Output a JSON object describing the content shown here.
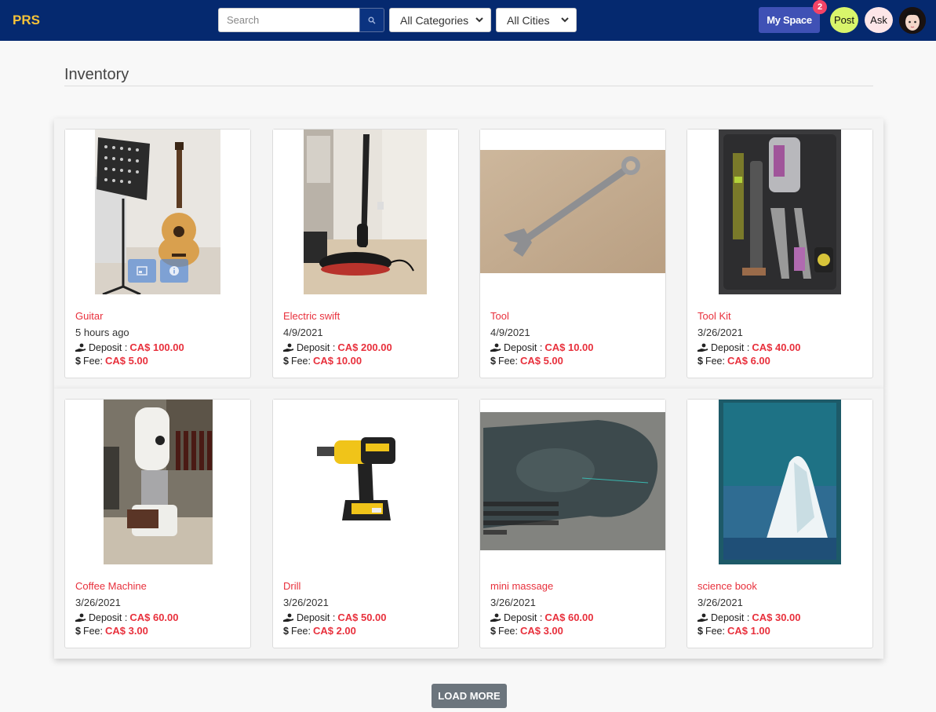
{
  "header": {
    "brand": "PRS",
    "search_placeholder": "Search",
    "category_select": "All Categories",
    "city_select": "All Cities",
    "my_space_label": "My Space",
    "notification_count": "2",
    "post_label": "Post",
    "ask_label": "Ask"
  },
  "page": {
    "title": "Inventory",
    "load_more_label": "LOAD MORE"
  },
  "labels": {
    "deposit": "Deposit :",
    "fee": "Fee:"
  },
  "items": [
    {
      "name": "Guitar",
      "date": "5 hours ago",
      "deposit": "CA$ 100.00",
      "fee": "CA$ 5.00"
    },
    {
      "name": "Electric swift",
      "date": "4/9/2021",
      "deposit": "CA$ 200.00",
      "fee": "CA$ 10.00"
    },
    {
      "name": "Tool",
      "date": "4/9/2021",
      "deposit": "CA$ 10.00",
      "fee": "CA$ 5.00"
    },
    {
      "name": "Tool Kit",
      "date": "3/26/2021",
      "deposit": "CA$ 40.00",
      "fee": "CA$ 6.00"
    },
    {
      "name": "Coffee Machine",
      "date": "3/26/2021",
      "deposit": "CA$ 60.00",
      "fee": "CA$ 3.00"
    },
    {
      "name": "Drill",
      "date": "3/26/2021",
      "deposit": "CA$ 50.00",
      "fee": "CA$ 2.00"
    },
    {
      "name": "mini massage",
      "date": "3/26/2021",
      "deposit": "CA$ 60.00",
      "fee": "CA$ 3.00"
    },
    {
      "name": "science book",
      "date": "3/26/2021",
      "deposit": "CA$ 30.00",
      "fee": "CA$ 1.00"
    }
  ],
  "colors": {
    "header_bg": "#05296f",
    "brand": "#f6c338",
    "accent_red": "#e8303c",
    "my_space": "#3f51b5",
    "badge": "#f44366",
    "post": "#d9f56b",
    "ask": "#fde6e8",
    "load_more": "#6c757d"
  },
  "icons": [
    "search-icon",
    "chevron-down-icon",
    "hand-coin-icon",
    "dollar-icon",
    "gallery-icon",
    "info-icon"
  ]
}
